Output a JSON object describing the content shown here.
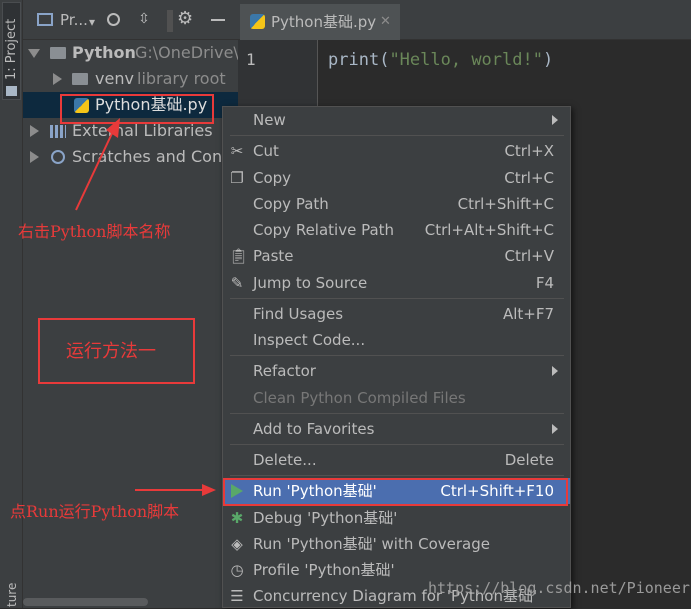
{
  "tool_window": {
    "project_tab_label": "1: Project",
    "structure_tab_label": "ture"
  },
  "project_toolbar": {
    "title": "Pr...",
    "dropdown_label": "▾"
  },
  "project_tree": {
    "root": {
      "name": "Python",
      "path": "G:\\OneDrive\\核"
    },
    "venv": {
      "name": "venv",
      "note": "library root"
    },
    "file": {
      "name": "Python基础.py"
    },
    "external": {
      "name": "External Libraries"
    },
    "scratches": {
      "name": "Scratches and Conso"
    }
  },
  "editor": {
    "tab_label": "Python基础.py",
    "line_number": "1",
    "code_func": "print",
    "code_open": "(",
    "code_string": "\"Hello, world!\"",
    "code_close": ")"
  },
  "context_menu": {
    "new": {
      "label": "New"
    },
    "cut": {
      "label": "Cut",
      "shortcut": "Ctrl+X"
    },
    "copy": {
      "label": "Copy",
      "shortcut": "Ctrl+C"
    },
    "copy_path": {
      "label": "Copy Path",
      "shortcut": "Ctrl+Shift+C"
    },
    "copy_relative_path": {
      "label": "Copy Relative Path",
      "shortcut": "Ctrl+Alt+Shift+C"
    },
    "paste": {
      "label": "Paste",
      "shortcut": "Ctrl+V"
    },
    "jump_to_source": {
      "label": "Jump to Source",
      "shortcut": "F4"
    },
    "find_usages": {
      "label": "Find Usages",
      "shortcut": "Alt+F7"
    },
    "inspect_code": {
      "label": "Inspect Code..."
    },
    "refactor": {
      "label": "Refactor"
    },
    "clean_compiled": {
      "label": "Clean Python Compiled Files"
    },
    "add_to_favorites": {
      "label": "Add to Favorites"
    },
    "delete": {
      "label": "Delete...",
      "shortcut": "Delete"
    },
    "run": {
      "label": "Run 'Python基础'",
      "shortcut": "Ctrl+Shift+F10"
    },
    "debug": {
      "label": "Debug 'Python基础'"
    },
    "run_coverage": {
      "label": "Run 'Python基础' with Coverage"
    },
    "profile": {
      "label": "Profile 'Python基础'"
    },
    "concurrency": {
      "label": "Concurrency Diagram for 'Python基础'"
    }
  },
  "annotations": {
    "right_click_note": "右击Python脚本名称",
    "method_one": "运行方法一",
    "click_run_note": "点Run运行Python脚本"
  },
  "watermark": "https://blog.csdn.net/PioneerFan",
  "colors": {
    "annotation_red": "#e83a3a",
    "selection_blue": "#4b6eaf",
    "run_green": "#499c54",
    "code_string": "#6a8759",
    "code_func": "#a9b7c6"
  }
}
